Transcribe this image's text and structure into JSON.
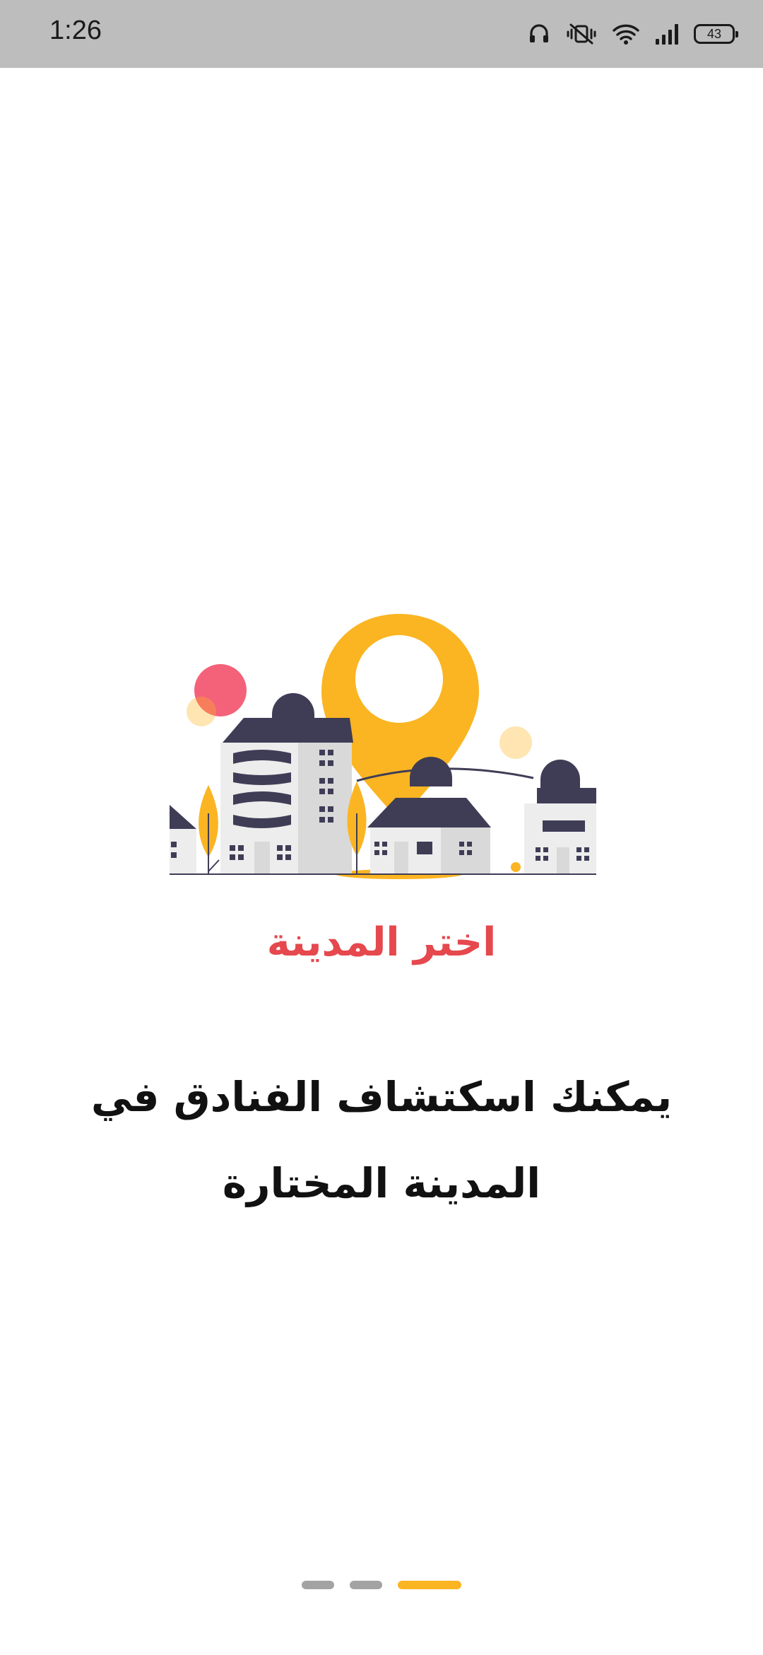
{
  "status_bar": {
    "time": "1:26",
    "battery_level": "43",
    "icons": [
      "headset-icon",
      "vibrate-mute-icon",
      "wifi-icon",
      "signal-icon",
      "battery-icon"
    ]
  },
  "onboarding": {
    "illustration": "city-location-pin-illustration",
    "title": "اختر المدينة",
    "description": "يمكنك اسكتشاف الفنادق في المدينة المختارة",
    "page_indicator": {
      "total_pages": 3,
      "current_page": 3
    }
  },
  "colors": {
    "accent": "#FBB522",
    "title": "#E5484D",
    "building_dark": "#3F3D56",
    "building_light": "#EDEDED",
    "indicator_inactive": "#A3A3A3",
    "status_bar_bg": "#BDBDBD"
  }
}
